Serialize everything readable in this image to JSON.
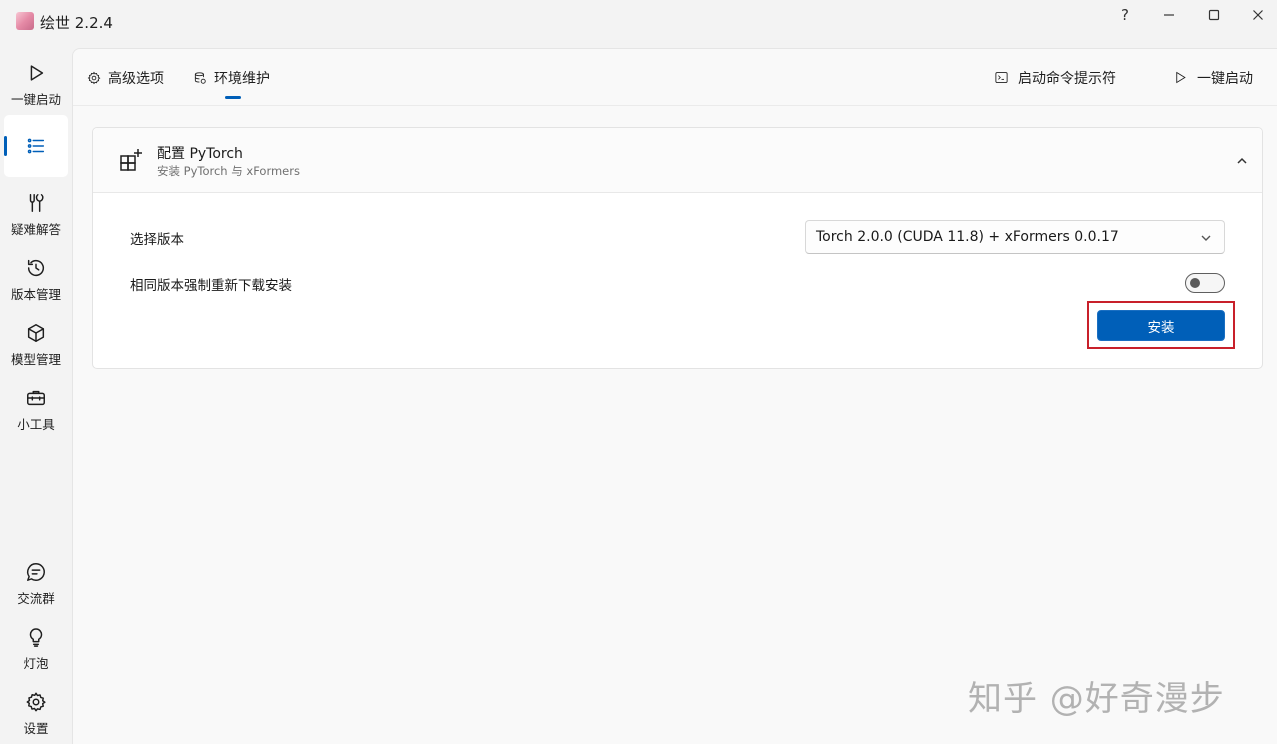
{
  "window": {
    "title": "绘世 2.2.4",
    "controls": {
      "help": "?",
      "minimize": "minimize-icon",
      "maximize": "maximize-icon",
      "close": "close-icon"
    }
  },
  "sidebar": {
    "items": [
      {
        "label": "一键启动",
        "icon": "play-icon"
      },
      {
        "label": "",
        "icon": "list-icon",
        "active": true
      },
      {
        "label": "疑难解答",
        "icon": "wrench-icon"
      },
      {
        "label": "版本管理",
        "icon": "history-icon"
      },
      {
        "label": "模型管理",
        "icon": "cube-icon"
      },
      {
        "label": "小工具",
        "icon": "toolbox-icon"
      }
    ],
    "bottom_items": [
      {
        "label": "交流群",
        "icon": "chat-icon"
      },
      {
        "label": "灯泡",
        "icon": "lightbulb-icon"
      },
      {
        "label": "设置",
        "icon": "gear-icon"
      }
    ]
  },
  "topbar": {
    "tabs": [
      {
        "label": "高级选项",
        "icon": "gear-icon"
      },
      {
        "label": "环境维护",
        "icon": "database-icon",
        "active": true
      }
    ],
    "commands": [
      {
        "label": "启动命令提示符",
        "icon": "terminal-icon"
      },
      {
        "label": "一键启动",
        "icon": "play-icon"
      }
    ]
  },
  "card": {
    "title": "配置 PyTorch",
    "subtitle": "安装 PyTorch 与 xFormers",
    "version_label": "选择版本",
    "version_value": "Torch 2.0.0 (CUDA 11.8) + xFormers 0.0.17",
    "force_label": "相同版本强制重新下载安装",
    "force_enabled": false,
    "install_label": "安装"
  },
  "watermark": "知乎 @好奇漫步",
  "colors": {
    "accent": "#005fb8",
    "highlight": "#c8202a"
  }
}
